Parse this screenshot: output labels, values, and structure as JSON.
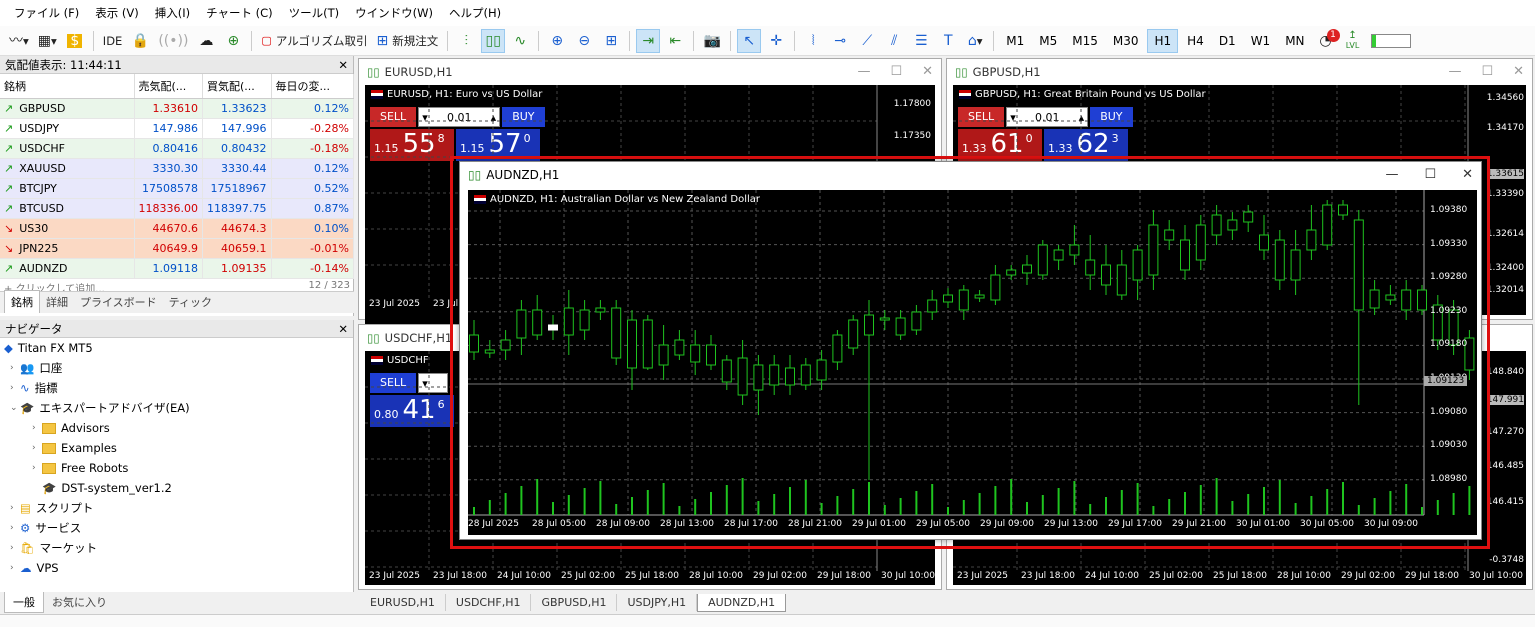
{
  "menu": [
    "ファイル (F)",
    "表示 (V)",
    "挿入(I)",
    "チャート (C)",
    "ツール(T)",
    "ウインドウ(W)",
    "ヘルプ(H)"
  ],
  "toolbar": {
    "ide": "IDE",
    "algo": "アルゴリズム取引",
    "new_order": "新規注文",
    "timeframes": [
      "M1",
      "M5",
      "M15",
      "M30",
      "H1",
      "H4",
      "D1",
      "W1",
      "MN"
    ],
    "active_tf": "H1",
    "notif_count": "1",
    "lvl": "LVL"
  },
  "market_watch": {
    "title": "気配値表示: 11:44:11",
    "headers": [
      "銘柄",
      "売気配(...",
      "買気配(...",
      "毎日の変..."
    ],
    "rows": [
      {
        "sym": "GBPUSD",
        "bid": "1.33610",
        "ask": "1.33623",
        "chg": "0.12%",
        "dir": "up"
      },
      {
        "sym": "USDJPY",
        "bid": "147.986",
        "ask": "147.996",
        "chg": "-0.28%",
        "dir": "up"
      },
      {
        "sym": "USDCHF",
        "bid": "0.80416",
        "ask": "0.80432",
        "chg": "-0.18%",
        "dir": "up"
      },
      {
        "sym": "XAUUSD",
        "bid": "3330.30",
        "ask": "3330.44",
        "chg": "0.12%",
        "dir": "up"
      },
      {
        "sym": "BTCJPY",
        "bid": "17508578",
        "ask": "17518967",
        "chg": "0.52%",
        "dir": "up"
      },
      {
        "sym": "BTCUSD",
        "bid": "118336.00",
        "ask": "118397.75",
        "chg": "0.87%",
        "dir": "up"
      },
      {
        "sym": "US30",
        "bid": "44670.6",
        "ask": "44674.3",
        "chg": "0.10%",
        "dir": "down"
      },
      {
        "sym": "JPN225",
        "bid": "40649.9",
        "ask": "40659.1",
        "chg": "-0.01%",
        "dir": "down"
      },
      {
        "sym": "AUDNZD",
        "bid": "1.09118",
        "ask": "1.09135",
        "chg": "-0.14%",
        "dir": "up"
      }
    ],
    "add_text": "クリックして追加...",
    "count": "12 / 323",
    "tabs": [
      "銘柄",
      "詳細",
      "プライスボード",
      "ティック"
    ]
  },
  "navigator": {
    "title": "ナビゲータ",
    "root": "Titan FX MT5",
    "items": [
      "口座",
      "指標",
      "エキスパートアドバイザ(EA)",
      "Advisors",
      "Examples",
      "Free Robots",
      "DST-system_ver1.2",
      "スクリプト",
      "サービス",
      "マーケット",
      "VPS"
    ],
    "tabs": [
      "一般",
      "お気に入り"
    ]
  },
  "windows": {
    "eurusd": {
      "title": "EURUSD,H1",
      "label": "EURUSD, H1:  Euro vs US Dollar",
      "lot": "0.01",
      "sell": "SELL",
      "buy": "BUY",
      "sell_pre": "1.15",
      "sell_big": "55",
      "sell_sup": "8",
      "buy_pre": "1.15",
      "buy_big": "57",
      "buy_sup": "0",
      "y": [
        "1.17800",
        "1.17350"
      ],
      "x": [
        "23 Jul 2025",
        "23 Jul 18:00",
        "24 Jul 10:00",
        "25 Jul 02:00",
        "25 Jul 18:00",
        "28 Jul 10:00",
        "29 Jul 02:00",
        "29 Jul 18:00",
        "30 Jul 10:00"
      ]
    },
    "gbpusd": {
      "title": "GBPUSD,H1",
      "label": "GBPUSD, H1:  Great Britain Pound vs US Dollar",
      "lot": "0.01",
      "sell": "SELL",
      "buy": "BUY",
      "sell_pre": "1.33",
      "sell_big": "61",
      "sell_sup": "0",
      "buy_pre": "1.33",
      "buy_big": "62",
      "buy_sup": "3",
      "y": [
        "1.34560",
        "1.34170",
        "1.33615",
        "1.33390",
        "1.32614",
        "1.32400",
        "1.32014"
      ],
      "x": [
        "23 Jul 2025",
        "23 Jul 18:00",
        "24 Jul 10:00",
        "25 Jul 02:00",
        "25 Jul 18:00",
        "28 Jul 10:00",
        "29 Jul 02:00",
        "29 Jul 18:00",
        "30 Jul 10:00"
      ]
    },
    "usdchf": {
      "title": "USDCHF,H1",
      "label": "USDCHF",
      "lot": "0.01",
      "sell": "SELL",
      "sell_pre": "0.80",
      "sell_big": "41",
      "sell_sup": "6",
      "y": [
        "148.840",
        "147.991",
        "147.270",
        "146.485",
        "146.415",
        "-0.3748"
      ],
      "x": [
        "23 Jul 2025",
        "23 Jul 18:00",
        "24 Jul 10:00",
        "25 Jul 02:00",
        "25 Jul 18:00",
        "28 Jul 10:00",
        "29 Jul 02:00",
        "29 Jul 18:00",
        "30 Jul 10:00"
      ]
    },
    "audnzd": {
      "title": "AUDNZD,H1",
      "label": "AUDNZD, H1:  Australian Dollar vs New Zealand Dollar",
      "y": [
        "1.09380",
        "1.09330",
        "1.09280",
        "1.09230",
        "1.09180",
        "1.09130",
        "1.09080",
        "1.09030",
        "1.08980"
      ],
      "current": "1.09123",
      "x": [
        "28 Jul 2025",
        "28 Jul 05:00",
        "28 Jul 09:00",
        "28 Jul 13:00",
        "28 Jul 17:00",
        "28 Jul 21:00",
        "29 Jul 01:00",
        "29 Jul 05:00",
        "29 Jul 09:00",
        "29 Jul 13:00",
        "29 Jul 17:00",
        "29 Jul 21:00",
        "30 Jul 01:00",
        "30 Jul 05:00",
        "30 Jul 09:00"
      ]
    }
  },
  "chart_tabs": [
    "EURUSD,H1",
    "USDCHF,H1",
    "GBPUSD,H1",
    "USDJPY,H1",
    "AUDNZD,H1"
  ],
  "active_chart_tab": "AUDNZD,H1"
}
